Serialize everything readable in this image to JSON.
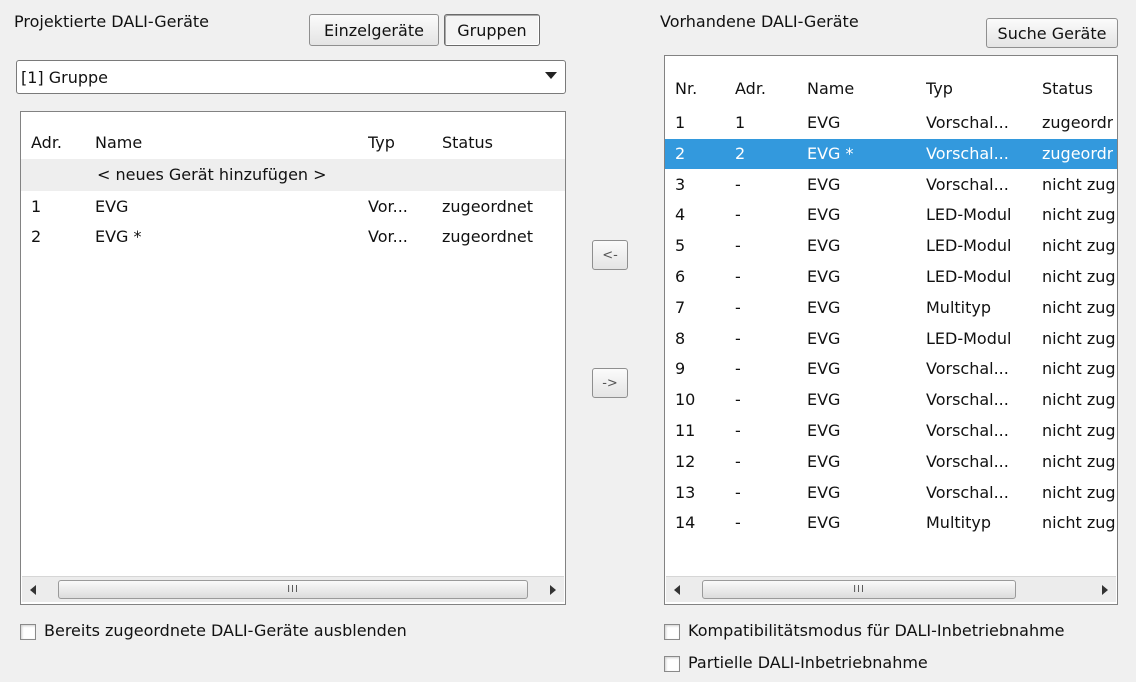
{
  "left_panel": {
    "title": "Projektierte DALI-Geräte",
    "toggle_buttons": [
      "Einzelgeräte",
      "Gruppen"
    ],
    "group_select": {
      "value": "[1] Gruppe"
    },
    "list": {
      "columns": [
        "Adr.",
        "Name",
        "Typ",
        "Status"
      ],
      "placeholder_row": "< neues Gerät hinzufügen >",
      "rows": [
        {
          "adr": "1",
          "name": "EVG",
          "typ": "Vor...",
          "status": "zugeordnet"
        },
        {
          "adr": "2",
          "name": "EVG *",
          "typ": "Vor...",
          "status": "zugeordnet"
        }
      ]
    },
    "scroll_grip": "III",
    "hide_checkbox_label": "Bereits zugeordnete DALI-Geräte ausblenden"
  },
  "transfer_buttons": {
    "to_left": "<-",
    "to_right": "->"
  },
  "right_panel": {
    "title": "Vorhandene DALI-Geräte",
    "search_button": "Suche Geräte",
    "list": {
      "columns": [
        "Nr.",
        "Adr.",
        "Name",
        "Typ",
        "Status"
      ],
      "selected_index": 1,
      "rows": [
        {
          "nr": "1",
          "adr": "1",
          "name": "EVG",
          "typ": "Vorschal...",
          "status": "zugeordr"
        },
        {
          "nr": "2",
          "adr": "2",
          "name": "EVG *",
          "typ": "Vorschal...",
          "status": "zugeordr"
        },
        {
          "nr": "3",
          "adr": "-",
          "name": "EVG",
          "typ": "Vorschal...",
          "status": "nicht zug"
        },
        {
          "nr": "4",
          "adr": "-",
          "name": "EVG",
          "typ": "LED-Modul",
          "status": "nicht zug"
        },
        {
          "nr": "5",
          "adr": "-",
          "name": "EVG",
          "typ": "LED-Modul",
          "status": "nicht zug"
        },
        {
          "nr": "6",
          "adr": "-",
          "name": "EVG",
          "typ": "LED-Modul",
          "status": "nicht zug"
        },
        {
          "nr": "7",
          "adr": "-",
          "name": "EVG",
          "typ": "Multityp",
          "status": "nicht zug"
        },
        {
          "nr": "8",
          "adr": "-",
          "name": "EVG",
          "typ": "LED-Modul",
          "status": "nicht zug"
        },
        {
          "nr": "9",
          "adr": "-",
          "name": "EVG",
          "typ": "Vorschal...",
          "status": "nicht zug"
        },
        {
          "nr": "10",
          "adr": "-",
          "name": "EVG",
          "typ": "Vorschal...",
          "status": "nicht zug"
        },
        {
          "nr": "11",
          "adr": "-",
          "name": "EVG",
          "typ": "Vorschal...",
          "status": "nicht zug"
        },
        {
          "nr": "12",
          "adr": "-",
          "name": "EVG",
          "typ": "Vorschal...",
          "status": "nicht zug"
        },
        {
          "nr": "13",
          "adr": "-",
          "name": "EVG",
          "typ": "Vorschal...",
          "status": "nicht zug"
        },
        {
          "nr": "14",
          "adr": "-",
          "name": "EVG",
          "typ": "Multityp",
          "status": "nicht zug"
        }
      ]
    },
    "scroll_grip": "III",
    "compat_checkbox_label": "Kompatibilitätsmodus für DALI-Inbetriebnahme",
    "partial_checkbox_label": "Partielle DALI-Inbetriebnahme"
  },
  "colors": {
    "selection": "#3399dd",
    "window_bg": "#f0f0f0"
  }
}
